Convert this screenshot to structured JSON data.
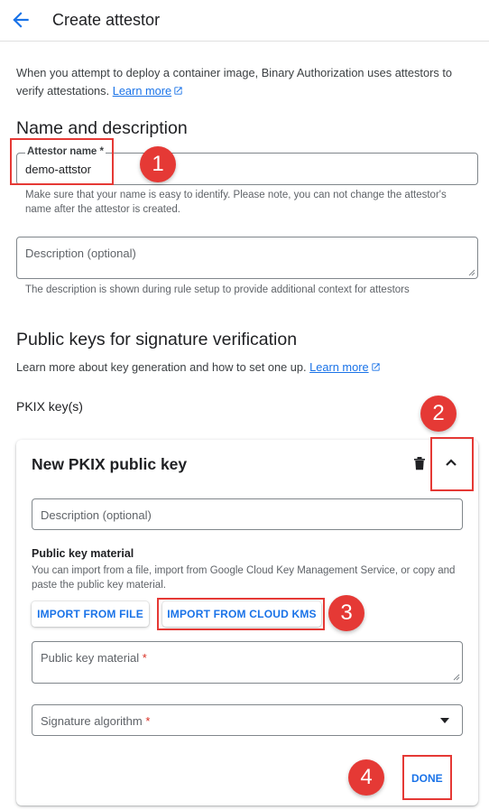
{
  "header": {
    "title": "Create attestor",
    "back_icon": "arrow-back-icon"
  },
  "intro": {
    "text": "When you attempt to deploy a container image, Binary Authorization uses attestors to verify attestations.",
    "link": "Learn more"
  },
  "name_section": {
    "heading": "Name and description",
    "attestor_name": {
      "label": "Attestor name",
      "required_mark": "*",
      "value": "demo-attstor",
      "helper": "Make sure that your name is easy to identify. Please note, you can not change the attestor's name after the attestor is created."
    },
    "description": {
      "placeholder": "Description (optional)",
      "helper": "The description is shown during rule setup to provide additional context for attestors"
    }
  },
  "keys_section": {
    "heading": "Public keys for signature verification",
    "text": "Learn more about key generation and how to set one up.",
    "link": "Learn more",
    "pkix_label": "PKIX key(s)"
  },
  "key_card": {
    "title": "New PKIX public key",
    "description_placeholder": "Description (optional)",
    "material_heading": "Public key material",
    "material_text": "You can import from a file, import from Google Cloud Key Management Service, or copy and paste the public key material.",
    "import_file_label": "IMPORT FROM FILE",
    "import_kms_label": "IMPORT FROM CLOUD KMS",
    "material_field_label": "Public key material",
    "material_required_mark": "*",
    "algorithm_label": "Signature algorithm",
    "algorithm_required_mark": "*",
    "done_label": "DONE"
  },
  "callouts": [
    "1",
    "2",
    "3",
    "4"
  ],
  "colors": {
    "accent": "#1a73e8",
    "callout": "#e53935",
    "required": "#d93025"
  }
}
